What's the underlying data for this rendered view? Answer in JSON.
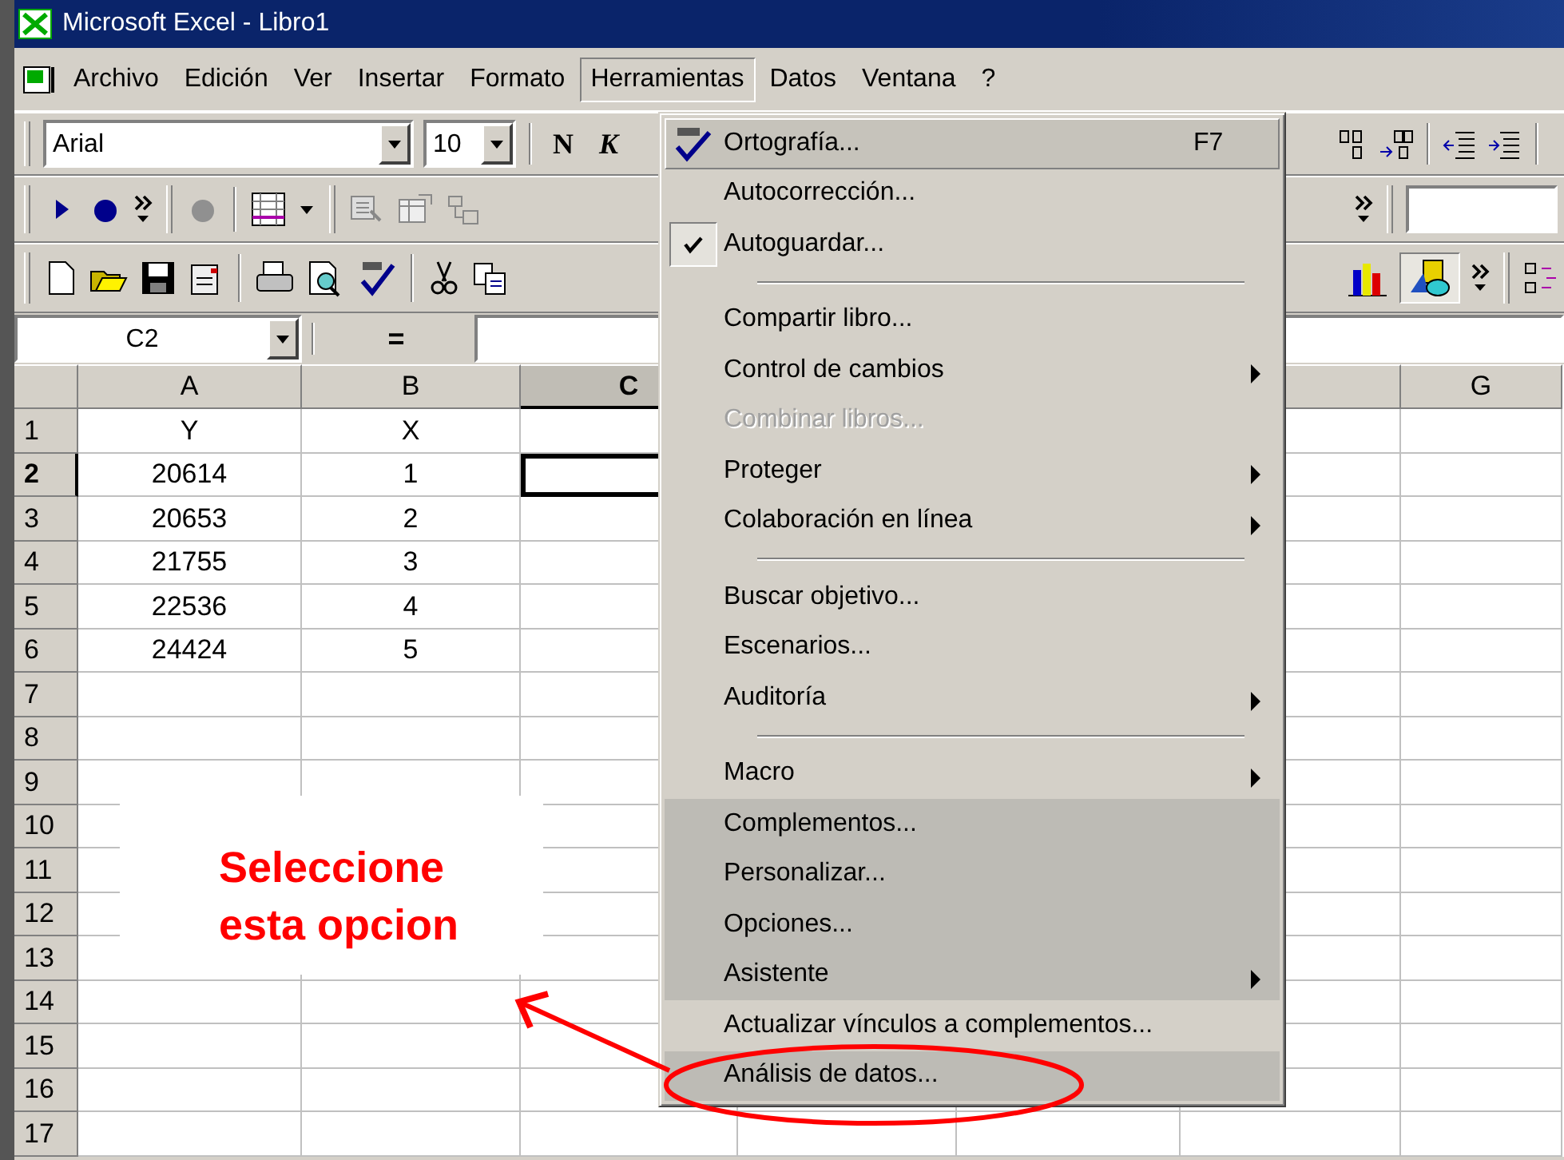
{
  "window": {
    "title": "Microsoft Excel - Libro1"
  },
  "menu_bar": [
    {
      "label": "Archivo",
      "selected": false
    },
    {
      "label": "Edición",
      "selected": false
    },
    {
      "label": "Ver",
      "selected": false
    },
    {
      "label": "Insertar",
      "selected": false
    },
    {
      "label": "Formato",
      "selected": false
    },
    {
      "label": "Herramientas",
      "selected": true
    },
    {
      "label": "Datos",
      "selected": false
    },
    {
      "label": "Ventana",
      "selected": false
    },
    {
      "label": "?",
      "selected": false
    }
  ],
  "formatting_toolbar": {
    "font": "Arial",
    "size": "10",
    "bold_button": "N",
    "italic_button": "K"
  },
  "formula_bar": {
    "name_box": "C2",
    "equals": "="
  },
  "sheet": {
    "columns": [
      {
        "label": "A",
        "selected": false
      },
      {
        "label": "B",
        "selected": false
      },
      {
        "label": "C",
        "selected": true
      },
      {
        "selected": false
      },
      {
        "label": "G",
        "selected": false
      }
    ],
    "rows": [
      {
        "label": "1",
        "selected": false,
        "cells": [
          "Y",
          "X"
        ]
      },
      {
        "label": "2",
        "selected": true,
        "cells": [
          "20614",
          "1"
        ]
      },
      {
        "label": "3",
        "selected": false,
        "cells": [
          "20653",
          "2"
        ]
      },
      {
        "label": "4",
        "selected": false,
        "cells": [
          "21755",
          "3"
        ]
      },
      {
        "label": "5",
        "selected": false,
        "cells": [
          "22536",
          "4"
        ]
      },
      {
        "label": "6",
        "selected": false,
        "cells": [
          "24424",
          "5"
        ]
      },
      {
        "label": "7",
        "selected": false
      },
      {
        "label": "8",
        "selected": false
      },
      {
        "label": "9",
        "selected": false
      },
      {
        "label": "10",
        "selected": false
      },
      {
        "label": "11",
        "selected": false
      },
      {
        "label": "12",
        "selected": false
      },
      {
        "label": "13",
        "selected": false
      },
      {
        "label": "14",
        "selected": false
      },
      {
        "label": "15",
        "selected": false
      },
      {
        "label": "16",
        "selected": false
      },
      {
        "label": "17",
        "selected": false
      }
    ]
  },
  "tools_menu": {
    "items": [
      {
        "kind": "icon_item",
        "label": "Ortografía...",
        "shortcut": "F7",
        "selected": true,
        "checked": false,
        "disabled": false,
        "submenu": false,
        "recessed": false
      },
      {
        "kind": "item",
        "label": "Autocorrección...",
        "selected": false,
        "checked": false,
        "disabled": false,
        "submenu": false,
        "recessed": false
      },
      {
        "kind": "item",
        "label": "Autoguardar...",
        "selected": false,
        "checked": true,
        "disabled": false,
        "submenu": false,
        "recessed": false
      },
      {
        "kind": "separator"
      },
      {
        "kind": "item",
        "label": "Compartir libro...",
        "selected": false,
        "checked": false,
        "disabled": false,
        "submenu": false,
        "recessed": false
      },
      {
        "kind": "item",
        "label": "Control de cambios",
        "selected": false,
        "checked": false,
        "disabled": false,
        "submenu": true,
        "recessed": false
      },
      {
        "kind": "item",
        "label": "Combinar libros...",
        "selected": false,
        "checked": false,
        "disabled": true,
        "submenu": false,
        "recessed": false
      },
      {
        "kind": "item",
        "label": "Proteger",
        "selected": false,
        "checked": false,
        "disabled": false,
        "submenu": true,
        "recessed": false
      },
      {
        "kind": "item",
        "label": "Colaboración en línea",
        "selected": false,
        "checked": false,
        "disabled": false,
        "submenu": true,
        "recessed": false
      },
      {
        "kind": "separator"
      },
      {
        "kind": "item",
        "label": "Buscar objetivo...",
        "selected": false,
        "checked": false,
        "disabled": false,
        "submenu": false,
        "recessed": false
      },
      {
        "kind": "item",
        "label": "Escenarios...",
        "selected": false,
        "checked": false,
        "disabled": false,
        "submenu": false,
        "recessed": false
      },
      {
        "kind": "item",
        "label": "Auditoría",
        "selected": false,
        "checked": false,
        "disabled": false,
        "submenu": true,
        "recessed": false
      },
      {
        "kind": "separator"
      },
      {
        "kind": "item",
        "label": "Macro",
        "selected": false,
        "checked": false,
        "disabled": false,
        "submenu": true,
        "recessed": false
      },
      {
        "kind": "item",
        "label": "Complementos...",
        "selected": false,
        "checked": false,
        "disabled": false,
        "submenu": false,
        "recessed": true
      },
      {
        "kind": "item",
        "label": "Personalizar...",
        "selected": false,
        "checked": false,
        "disabled": false,
        "submenu": false,
        "recessed": true
      },
      {
        "kind": "item",
        "label": "Opciones...",
        "selected": false,
        "checked": false,
        "disabled": false,
        "submenu": false,
        "recessed": true
      },
      {
        "kind": "item",
        "label": "Asistente",
        "selected": false,
        "checked": false,
        "disabled": false,
        "submenu": true,
        "recessed": true
      },
      {
        "kind": "item",
        "label": "Actualizar vínculos a complementos...",
        "selected": false,
        "checked": false,
        "disabled": false,
        "submenu": false,
        "recessed": false
      },
      {
        "kind": "item",
        "label": "Análisis de datos...",
        "selected": false,
        "checked": false,
        "disabled": false,
        "submenu": false,
        "recessed": true
      }
    ]
  },
  "annotation": {
    "text": "Seleccione esta opcion"
  }
}
